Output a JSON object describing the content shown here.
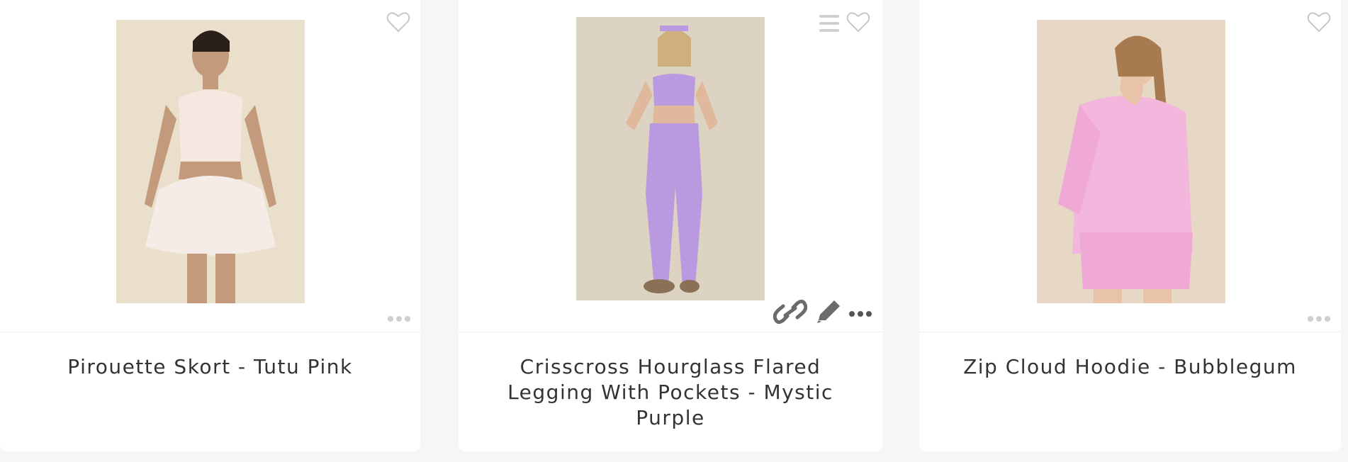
{
  "products": [
    {
      "title": "Pirouette Skort - Tutu Pink",
      "favorite_icon": "heart-outline-icon",
      "more_icon": "more-horizontal-icon",
      "accent": "#f5e9e4"
    },
    {
      "title": "Crisscross Hourglass Flared Legging With Pockets - Mystic Purple",
      "favorite_icon": "heart-outline-icon",
      "menu_icon": "hamburger-menu-icon",
      "action_icons": [
        "link-icon",
        "pencil-icon",
        "more-horizontal-icon"
      ],
      "accent": "#b999e0"
    },
    {
      "title": "Zip Cloud Hoodie - Bubblegum",
      "favorite_icon": "heart-outline-icon",
      "more_icon": "more-horizontal-icon",
      "accent": "#f2a9d8"
    }
  ],
  "colors": {
    "page_background": "#f6f6f6",
    "card_background": "#ffffff",
    "text": "#333333",
    "icon_light": "#c8c8c8",
    "icon_dark": "#6b6b6b"
  }
}
